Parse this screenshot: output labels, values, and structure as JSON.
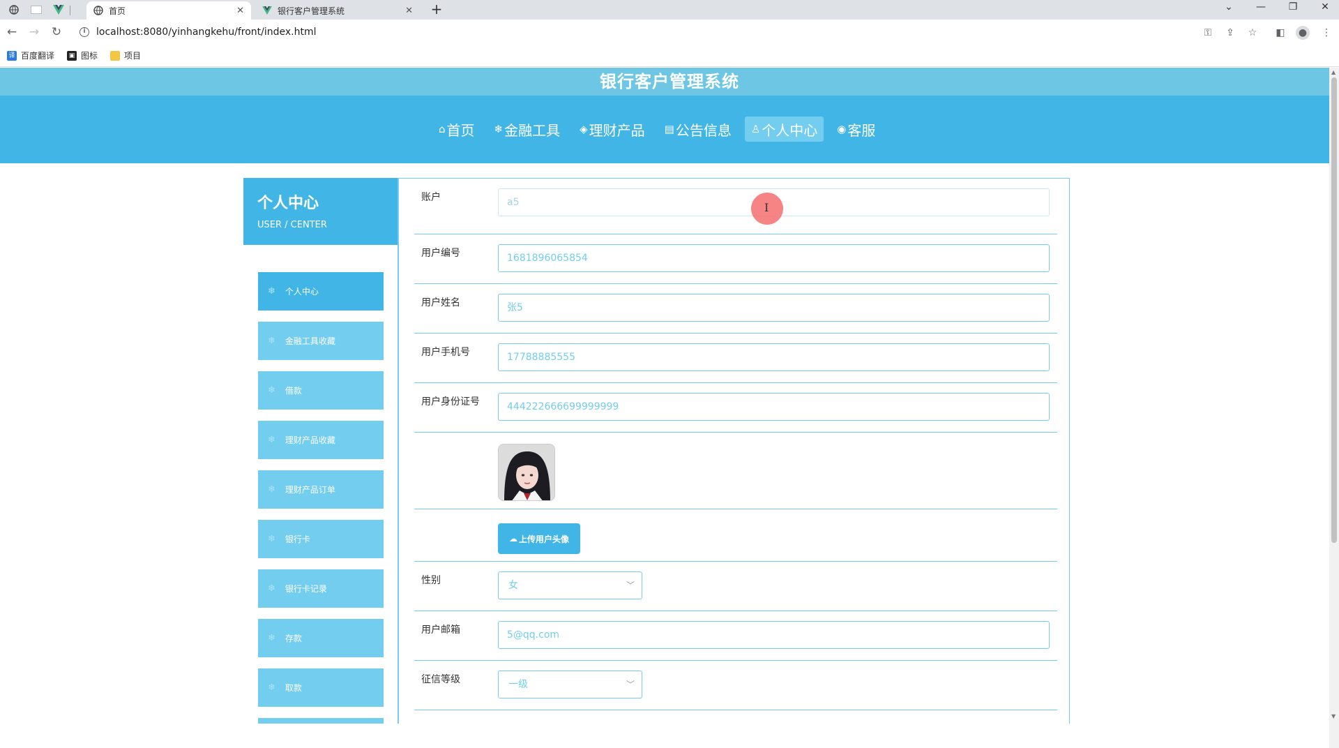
{
  "browser": {
    "tabs": [
      {
        "title": "首页",
        "active": true
      },
      {
        "title": "银行客户管理系统",
        "active": false
      }
    ],
    "url": "localhost:8080/yinhangkehu/front/index.html",
    "bookmarks": [
      "百度翻译",
      "图标",
      "项目"
    ]
  },
  "site": {
    "title": "银行客户管理系统",
    "nav": [
      {
        "icon": "⌂",
        "label": "首页",
        "active": false
      },
      {
        "icon": "❄",
        "label": "金融工具",
        "active": false
      },
      {
        "icon": "◈",
        "label": "理财产品",
        "active": false
      },
      {
        "icon": "▤",
        "label": "公告信息",
        "active": false
      },
      {
        "icon": "♙",
        "label": "个人中心",
        "active": true
      },
      {
        "icon": "◉",
        "label": "客服",
        "active": false
      }
    ]
  },
  "sidebar": {
    "title": "个人中心",
    "subtitle": "USER / CENTER",
    "items": [
      {
        "label": "个人中心",
        "active": true
      },
      {
        "label": "金融工具收藏",
        "active": false
      },
      {
        "label": "借款",
        "active": false
      },
      {
        "label": "理财产品收藏",
        "active": false
      },
      {
        "label": "理财产品订单",
        "active": false
      },
      {
        "label": "银行卡",
        "active": false
      },
      {
        "label": "银行卡记录",
        "active": false
      },
      {
        "label": "存款",
        "active": false
      },
      {
        "label": "取款",
        "active": false
      }
    ]
  },
  "form": {
    "account_label": "账户",
    "account_value": "a5",
    "user_no_label": "用户编号",
    "user_no_value": "1681896065854",
    "name_label": "用户姓名",
    "name_value": "张5",
    "phone_label": "用户手机号",
    "phone_value": "17788885555",
    "idcard_label": "用户身份证号",
    "idcard_value": "444222666699999999",
    "upload_label": "上传用户头像",
    "gender_label": "性别",
    "gender_value": "女",
    "email_label": "用户邮箱",
    "email_value": "5@qq.com",
    "credit_label": "征信等级",
    "credit_value": "一级"
  },
  "colors": {
    "primary": "#41b6e6",
    "light": "#72cdee",
    "title_bar": "#6cc6e4"
  }
}
